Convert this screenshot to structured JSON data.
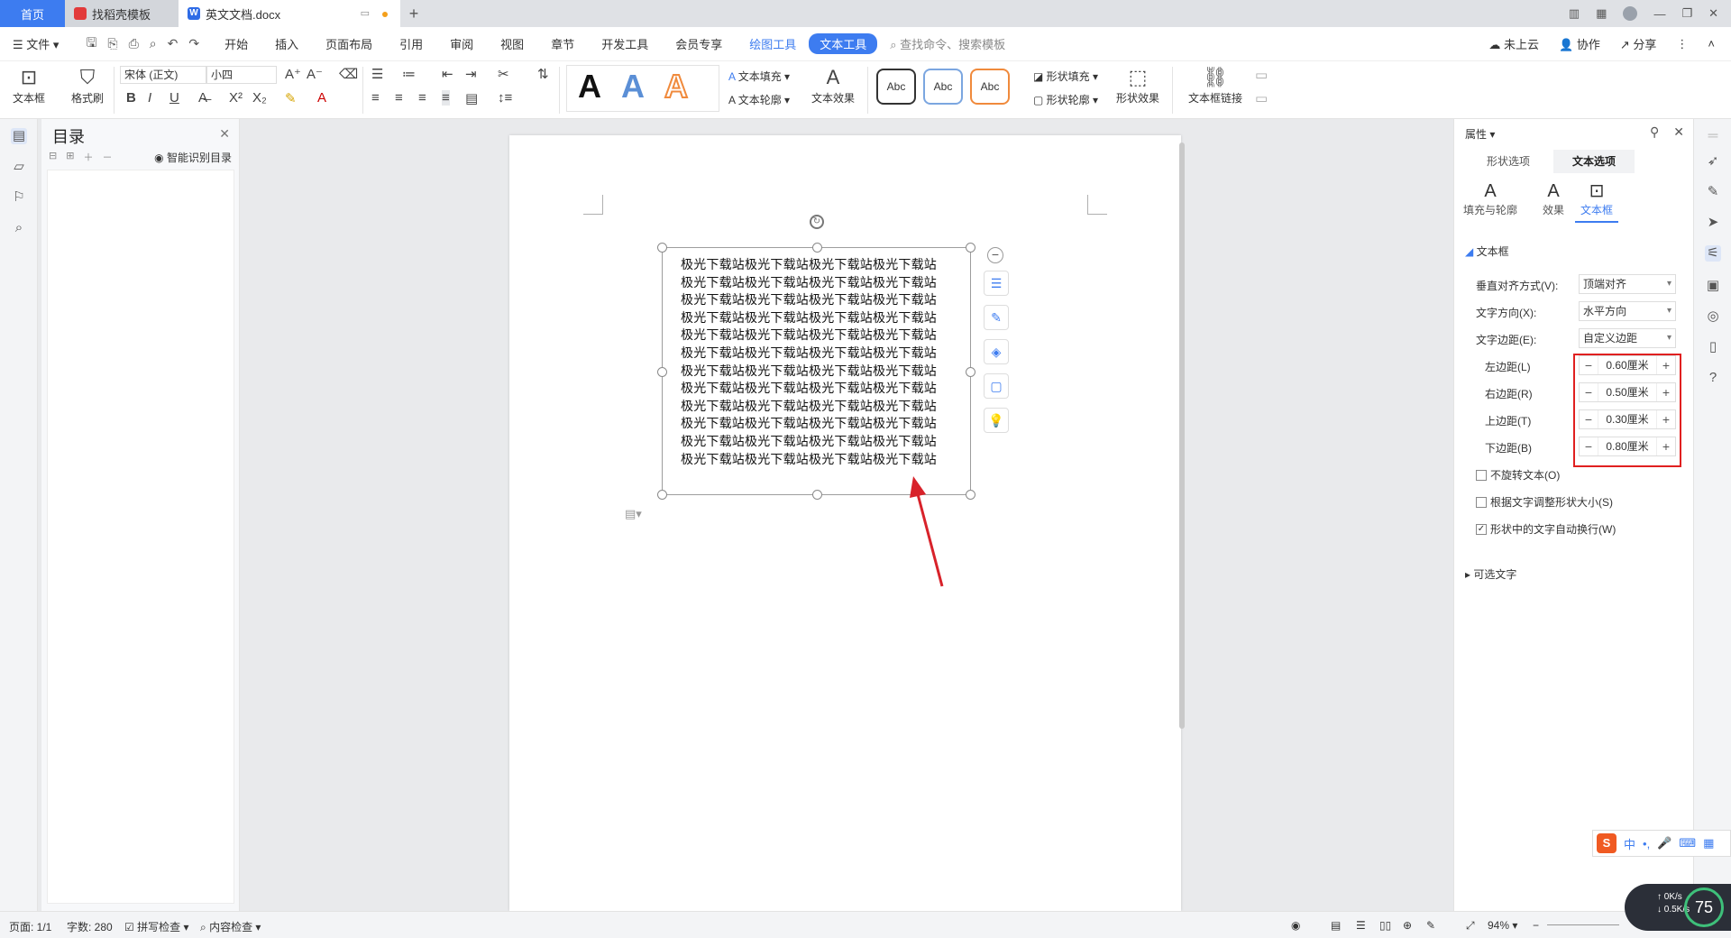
{
  "tabs": {
    "home": "首页",
    "tab1": "找稻壳模板",
    "tab2": "英文文档.docx",
    "add": "+"
  },
  "menu": {
    "file": "文件",
    "items": [
      "开始",
      "插入",
      "页面布局",
      "引用",
      "审阅",
      "视图",
      "章节",
      "开发工具",
      "会员专享"
    ],
    "drawing_tools": "绘图工具",
    "text_tools": "文本工具",
    "search": "查找命令、搜索模板",
    "cloud": "未上云",
    "collab": "协作",
    "share": "分享"
  },
  "ribbon": {
    "textbox": "文本框",
    "format_painter": "格式刷",
    "font": "宋体 (正文)",
    "size": "小四",
    "text_fill": "文本填充",
    "text_outline": "文本轮廓",
    "text_effect": "文本效果",
    "abc": "Abc",
    "shape_fill": "形状填充",
    "shape_outline": "形状轮廓",
    "shape_effect": "形状效果",
    "textbox_link": "文本框链接"
  },
  "toc": {
    "title": "目录",
    "smart": "智能识别目录"
  },
  "document": {
    "line_text": "极光下载站极光下载站极光下载站极光下载站",
    "line_count": 12
  },
  "props": {
    "header": "属性",
    "tab_shape": "形状选项",
    "tab_text": "文本选项",
    "sub_fill": "填充与轮廓",
    "sub_effect": "效果",
    "sub_textbox": "文本框",
    "section_textbox": "文本框",
    "valign_label": "垂直对齐方式(V):",
    "valign_value": "顶端对齐",
    "direction_label": "文字方向(X):",
    "direction_value": "水平方向",
    "margin_label": "文字边距(E):",
    "margin_value": "自定义边距",
    "left_label": "左边距(L)",
    "left_value": "0.60厘米",
    "right_label": "右边距(R)",
    "right_value": "0.50厘米",
    "top_label": "上边距(T)",
    "top_value": "0.30厘米",
    "bottom_label": "下边距(B)",
    "bottom_value": "0.80厘米",
    "no_rotate": "不旋转文本(O)",
    "autofit": "根据文字调整形状大小(S)",
    "wrap": "形状中的文字自动换行(W)",
    "alt_text": "可选文字"
  },
  "status": {
    "page": "页面: 1/1",
    "words": "字数: 280",
    "spell": "拼写检查",
    "content": "内容检查",
    "zoom": "94%"
  },
  "ime": {
    "label": "中"
  },
  "speed": {
    "up": "0K/s",
    "down": "0.5K/s",
    "percent": "75"
  },
  "colors": {
    "accent": "#3d7cf0",
    "highlight": "#e02020"
  }
}
